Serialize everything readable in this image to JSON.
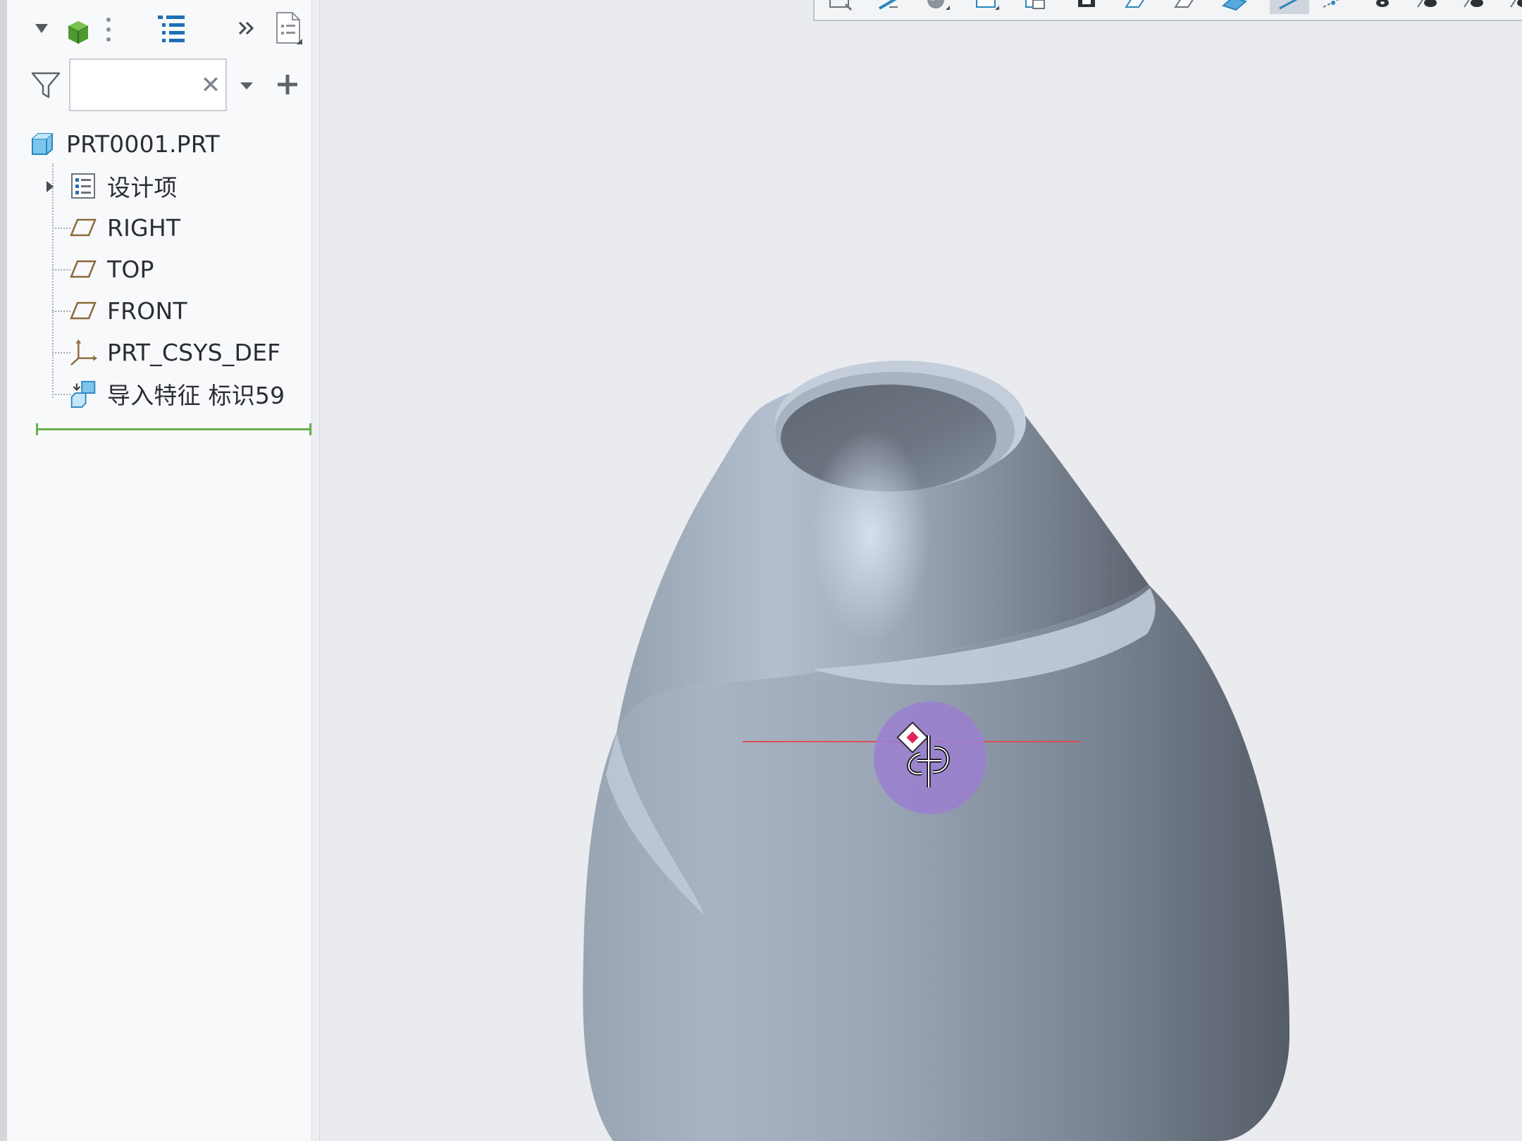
{
  "colors": {
    "panel_bg": "#f8f9fb",
    "viewport_bg": "#e9ebef",
    "insert_line": "#6bb04a",
    "model_body": "#8b95a3",
    "spin_center": "#9a7fd0",
    "axis_line": "#e0484f"
  },
  "navigator": {
    "toolbar_icons": [
      "model-tree-icon",
      "tree-settings-icon",
      "expand-more-icon",
      "model-properties-icon"
    ],
    "filter": {
      "value": "",
      "placeholder": "",
      "icon": "filter-funnel-icon",
      "clear_icon": "close-icon",
      "dropdown_icon": "caret-down-icon",
      "add_icon": "plus-icon"
    },
    "tree": {
      "root": {
        "label": "PRT0001.PRT",
        "icon": "part-icon"
      },
      "items": [
        {
          "label": "设计项",
          "icon": "design-items-icon",
          "expandable": true
        },
        {
          "label": "RIGHT",
          "icon": "datum-plane-icon"
        },
        {
          "label": "TOP",
          "icon": "datum-plane-icon"
        },
        {
          "label": "FRONT",
          "icon": "datum-plane-icon"
        },
        {
          "label": "PRT_CSYS_DEF",
          "icon": "coordinate-system-icon"
        },
        {
          "label": "导入特征 标识59",
          "icon": "import-feature-icon"
        }
      ]
    }
  },
  "graphics_toolbar": {
    "icons": [
      "refit-icon",
      "zoom-in-icon",
      "shading-icon",
      "view-manager-icon",
      "saved-orientations-icon",
      "display-style-icon",
      "section-icon",
      "perspective-icon",
      "plane-display-icon",
      "axis-display-icon",
      "point-display-icon",
      "csys-display-icon",
      "annotation-display-icon",
      "spin-center-icon",
      "appearance-icon",
      "render-icon",
      "visibility-icon",
      "selection-icon"
    ]
  },
  "viewport": {
    "model": "nozzle-part-shaded",
    "spin_center": "spin-center-marker"
  }
}
